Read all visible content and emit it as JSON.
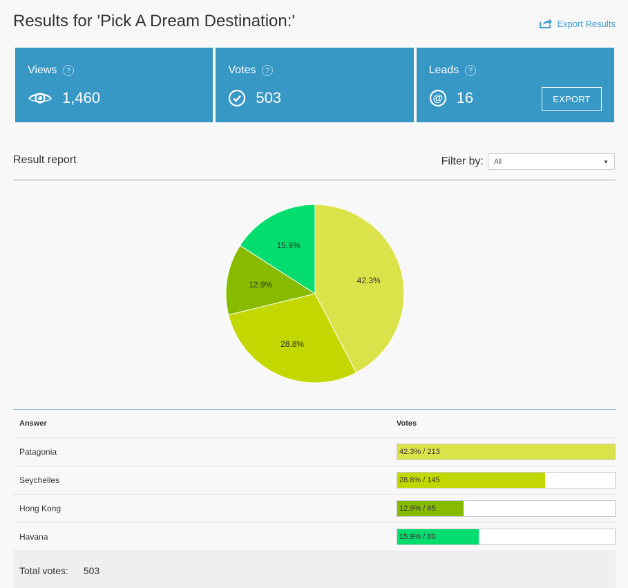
{
  "header": {
    "title": "Results for 'Pick A Dream Destination:'",
    "export_link": "Export Results"
  },
  "stats": [
    {
      "label": "Views",
      "value": "1,460",
      "icon": "eye-icon"
    },
    {
      "label": "Votes",
      "value": "503",
      "icon": "check-circle-icon"
    },
    {
      "label": "Leads",
      "value": "16",
      "icon": "at-icon",
      "button": "EXPORT"
    }
  ],
  "report": {
    "title": "Result report",
    "filter_label": "Filter by:",
    "filter_value": "All"
  },
  "chart_data": {
    "type": "pie",
    "slices": [
      {
        "label": "Patagonia",
        "value": 42.3,
        "display": "42.3%",
        "color": "#dce34a"
      },
      {
        "label": "Seychelles",
        "value": 28.8,
        "display": "28.8%",
        "color": "#c3d800"
      },
      {
        "label": "Hong Kong",
        "value": 12.9,
        "display": "12.9%",
        "color": "#86bb00"
      },
      {
        "label": "Havana",
        "value": 15.9,
        "display": "15.9%",
        "color": "#05dd6e"
      }
    ]
  },
  "table": {
    "headers": [
      "Answer",
      "Votes"
    ],
    "rows": [
      {
        "answer": "Patagonia",
        "votes_text": "42.3% / 213",
        "fraction": 1.0,
        "color": "#dce34a"
      },
      {
        "answer": "Seychelles",
        "votes_text": "28.8% / 145",
        "fraction": 0.68,
        "color": "#c3d800"
      },
      {
        "answer": "Hong Kong",
        "votes_text": "12.9% / 65",
        "fraction": 0.305,
        "color": "#86bb00"
      },
      {
        "answer": "Havana",
        "votes_text": "15.9% / 80",
        "fraction": 0.375,
        "color": "#05dd6e"
      }
    ],
    "total_label": "Total votes:",
    "total_value": "503"
  },
  "colors": {
    "accent": "#3797c5",
    "link": "#3a9ccc"
  }
}
